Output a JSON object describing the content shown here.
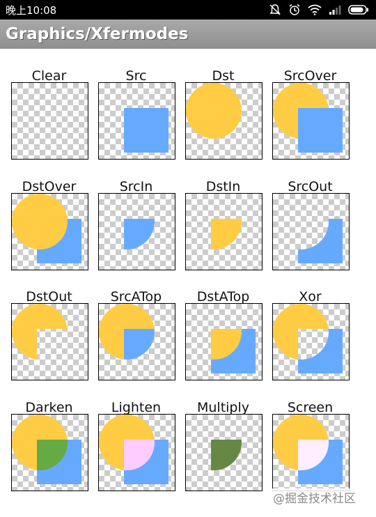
{
  "status": {
    "time": "晚上10:08"
  },
  "action_bar": {
    "title": "Graphics/Xfermodes"
  },
  "colors": {
    "dst_circle": "#ffcc44",
    "src_square": "#66aaff",
    "darken_overlap": "#66aa44",
    "lighten_overlap": "#ffccff",
    "multiply_overlap": "#668844",
    "screen_overlap": "#ffeeff",
    "checker": "#cccccc"
  },
  "modes": [
    {
      "label": "Clear",
      "mode": "clear"
    },
    {
      "label": "Src",
      "mode": "src"
    },
    {
      "label": "Dst",
      "mode": "dst"
    },
    {
      "label": "SrcOver",
      "mode": "srcover"
    },
    {
      "label": "DstOver",
      "mode": "dstover"
    },
    {
      "label": "SrcIn",
      "mode": "srcin"
    },
    {
      "label": "DstIn",
      "mode": "dstin"
    },
    {
      "label": "SrcOut",
      "mode": "srcout"
    },
    {
      "label": "DstOut",
      "mode": "dstout"
    },
    {
      "label": "SrcATop",
      "mode": "srcatop"
    },
    {
      "label": "DstATop",
      "mode": "dstatop"
    },
    {
      "label": "Xor",
      "mode": "xor"
    },
    {
      "label": "Darken",
      "mode": "darken"
    },
    {
      "label": "Lighten",
      "mode": "lighten"
    },
    {
      "label": "Multiply",
      "mode": "multiply"
    },
    {
      "label": "Screen",
      "mode": "screen"
    }
  ],
  "watermark": "@掘金技术社区"
}
